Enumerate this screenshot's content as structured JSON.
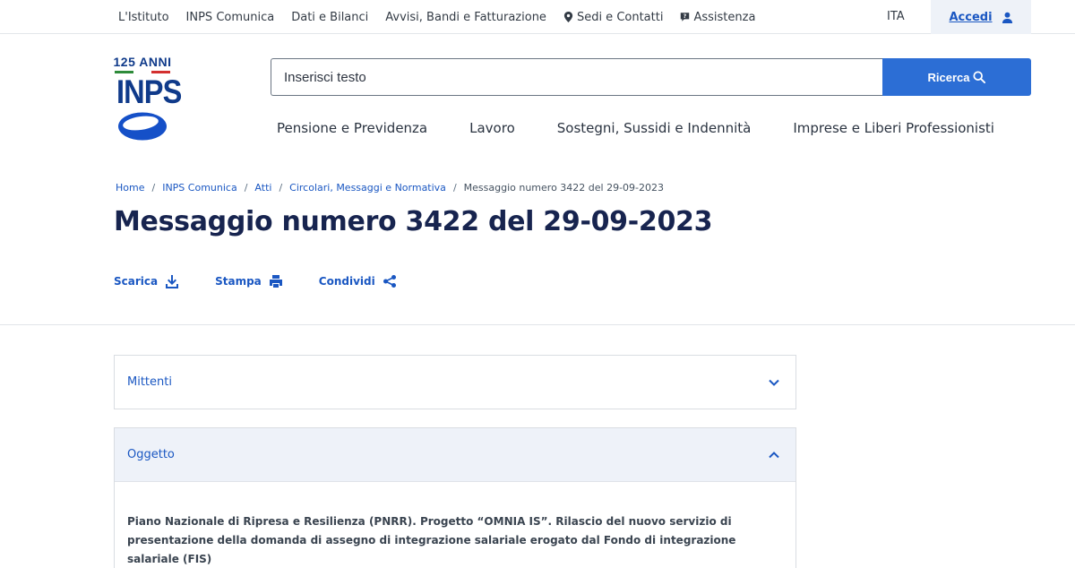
{
  "topbar": {
    "links": [
      "L'Istituto",
      "INPS Comunica",
      "Dati e Bilanci",
      "Avvisi, Bandi e Fatturazione"
    ],
    "sedi_label": "Sedi e Contatti",
    "sedi_icon": "map-pin-icon",
    "assistenza_label": "Assistenza",
    "assistenza_icon": "help-chat-icon",
    "lang": "ITA",
    "login_label": "Accedi",
    "login_icon": "user-icon"
  },
  "logo": {
    "anniversary": "125 ANNI",
    "name": "INPS"
  },
  "search": {
    "placeholder": "Inserisci testo",
    "button_label": "Ricerca",
    "button_icon": "search-icon"
  },
  "nav": [
    "Pensione e Previdenza",
    "Lavoro",
    "Sostegni, Sussidi e Indennità",
    "Imprese e Liberi Professionisti"
  ],
  "breadcrumb": {
    "items": [
      "Home",
      "INPS Comunica",
      "Atti",
      "Circolari, Messaggi e Normativa"
    ],
    "current": "Messaggio numero 3422 del 29-09-2023",
    "separator": "/"
  },
  "page": {
    "title": "Messaggio numero 3422 del 29-09-2023"
  },
  "actions": {
    "download": "Scarica",
    "print": "Stampa",
    "share": "Condividi"
  },
  "accordions": {
    "mittenti": {
      "label": "Mittenti",
      "expanded": false
    },
    "oggetto": {
      "label": "Oggetto",
      "expanded": true,
      "content": "Piano Nazionale di Ripresa e Resilienza (PNRR). Progetto “OMNIA IS”. Rilascio del nuovo servizio di presentazione della domanda di assegno di integrazione salariale erogato dal Fondo di integrazione salariale (FIS)"
    }
  },
  "colors": {
    "primary_blue": "#1a57c2",
    "button_blue": "#2c6ed5",
    "title_navy": "#17244f",
    "logo_blue": "#0f3a8a"
  }
}
